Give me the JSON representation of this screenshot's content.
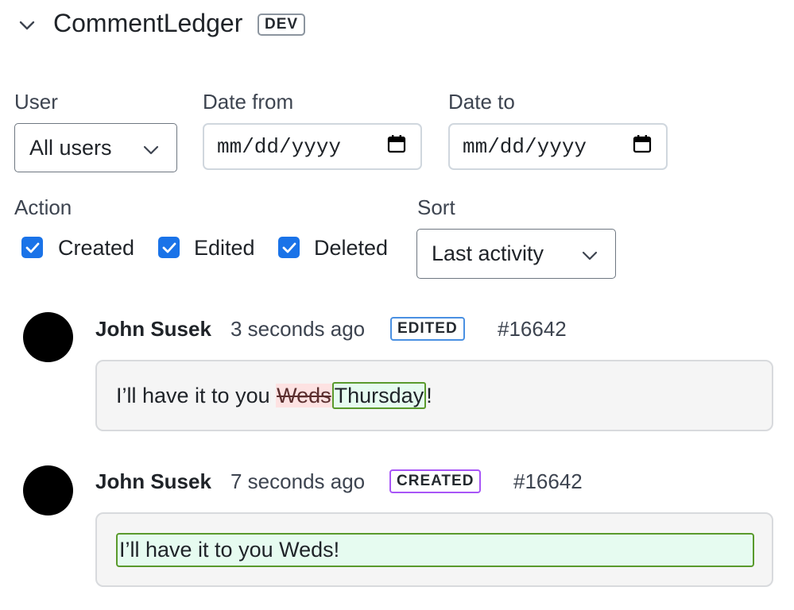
{
  "header": {
    "title": "CommentLedger",
    "badge": "DEV"
  },
  "filters": {
    "user": {
      "label": "User",
      "value": "All users"
    },
    "date_from": {
      "label": "Date from",
      "placeholder": "mm/dd/yyyy"
    },
    "date_to": {
      "label": "Date to",
      "placeholder": "mm/dd/yyyy"
    },
    "action": {
      "label": "Action",
      "options": [
        {
          "label": "Created",
          "checked": true
        },
        {
          "label": "Edited",
          "checked": true
        },
        {
          "label": "Deleted",
          "checked": true
        }
      ]
    },
    "sort": {
      "label": "Sort",
      "value": "Last activity"
    }
  },
  "colors": {
    "checkbox": "#1a73e8",
    "badge_edited": "#4a90e2",
    "badge_created": "#a855f7",
    "deleted_bg": "#fde2e2",
    "inserted_bg": "#e6fbf0",
    "inserted_border": "#5a9a2c"
  },
  "entries": [
    {
      "author": "John Susek",
      "time": "3 seconds ago",
      "badge": "EDITED",
      "id": "#16642",
      "diff": {
        "prefix": "I’ll have it to you ",
        "deleted": "Weds",
        "inserted": "Thursday",
        "suffix": "!"
      }
    },
    {
      "author": "John Susek",
      "time": "7 seconds ago",
      "badge": "CREATED",
      "id": "#16642",
      "diff": {
        "inserted": "I’ll have it to you Weds!"
      }
    }
  ]
}
